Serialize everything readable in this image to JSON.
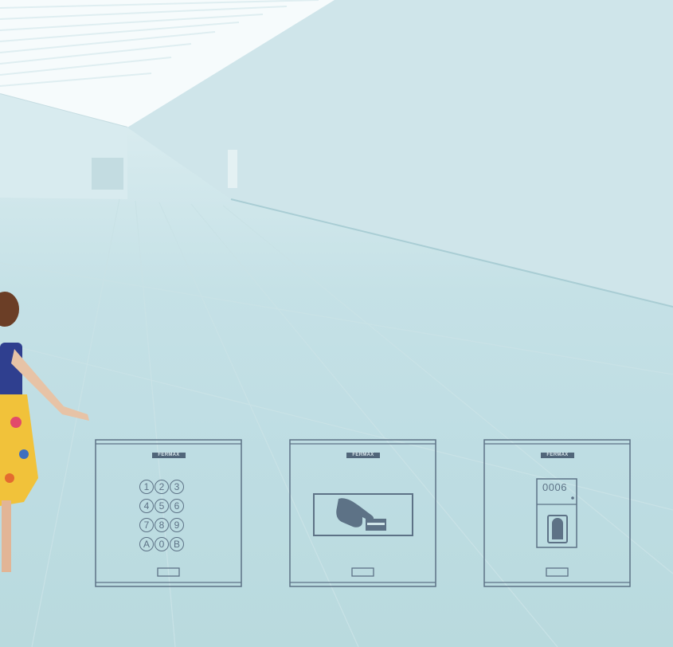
{
  "panels": [
    {
      "brand": "FERMAX",
      "type": "keypad",
      "keys": [
        "1",
        "2",
        "3",
        "4",
        "5",
        "6",
        "7",
        "8",
        "9",
        "A",
        "0",
        "B"
      ]
    },
    {
      "brand": "FERMAX",
      "type": "card-reader"
    },
    {
      "brand": "FERMAX",
      "type": "biometric",
      "display": "0006"
    }
  ],
  "colors": {
    "panel_line": "#5d7286",
    "brand_bg": "#51667a"
  }
}
